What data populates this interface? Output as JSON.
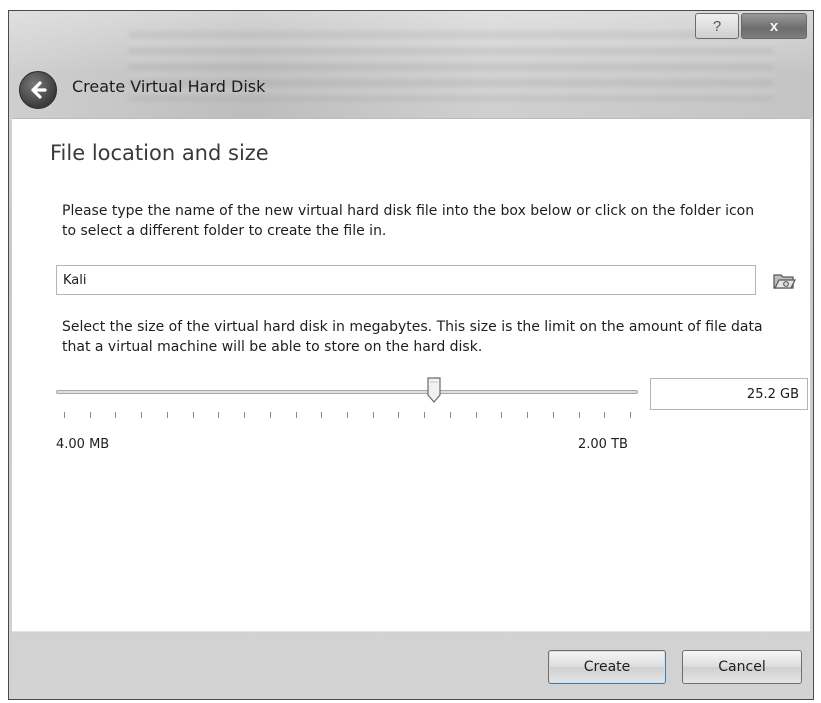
{
  "window": {
    "title": "Create Virtual Hard Disk",
    "help_label": "?",
    "close_label": "x"
  },
  "page": {
    "section_title": "File location and size",
    "location_instructions": "Please type the name of the new virtual hard disk file into the box below or click on the folder icon to select a different folder to create the file in.",
    "file_name_value": "Kali",
    "size_instructions": "Select the size of the virtual hard disk in megabytes. This size is the limit on the amount of file data that a virtual machine will be able to store on the hard disk.",
    "size_value": "25.2 GB",
    "slider": {
      "min_label": "4.00 MB",
      "max_label": "2.00 TB",
      "position_fraction": 0.65
    }
  },
  "buttons": {
    "create": "Create",
    "cancel": "Cancel"
  },
  "icons": {
    "back": "back-arrow-icon",
    "folder": "folder-icon"
  }
}
